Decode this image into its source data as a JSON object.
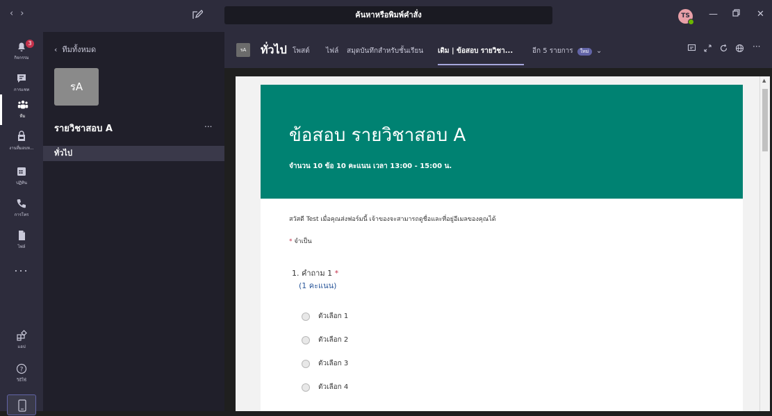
{
  "titlebar": {
    "search_placeholder": "ค้นหาหรือพิมพ์คำสั่ง",
    "user_initials": "TS"
  },
  "rail": {
    "items": [
      {
        "label": "กิจกรรม",
        "badge": "3"
      },
      {
        "label": "การแชท"
      },
      {
        "label": "ทีม"
      },
      {
        "label": "งานที่มอบห..."
      },
      {
        "label": "ปฏิทิน"
      },
      {
        "label": "การโทร"
      },
      {
        "label": "ไฟล์"
      },
      {
        "label": "แอป"
      },
      {
        "label": "วิธีใช้"
      }
    ],
    "more": "..."
  },
  "panel": {
    "back_label": "ทีมทั้งหมด",
    "team_tile": "รA",
    "team_name": "รายวิชาสอบ A",
    "more": "...",
    "channel": "ทั่วไป"
  },
  "header": {
    "channel_avatar": "รA",
    "channel_name": "ทั่วไป",
    "tabs": [
      "โพสต์",
      "ไฟล์",
      "สมุดบันทึกสำหรับชั้นเรียน",
      "เดิม | ข้อสอบ รายวิชา...",
      "อีก 5 รายการ"
    ],
    "new_badge": "ใหม่"
  },
  "form": {
    "title": "ข้อสอบ รายวิชาสอบ A",
    "description": "จำนวน 10 ข้อ 10 คะแนน เวลา 13:00 - 15:00 น.",
    "greeting": "สวัสดี Test เมื่อคุณส่งฟอร์มนี้ เจ้าของจะสามารถดูชื่อและที่อยู่อีเมลของคุณได้",
    "required_star": "*",
    "required_label": "จำเป็น",
    "question": "1. คำถาม 1",
    "question_star": "*",
    "points": "(1 คะแนน)",
    "options": [
      "ตัวเลือก 1",
      "ตัวเลือก 2",
      "ตัวเลือก 3",
      "ตัวเลือก 4"
    ]
  },
  "colors": {
    "rail_bg": "#2d2c3c",
    "form_banner": "#008272",
    "accent": "#6264a7"
  }
}
